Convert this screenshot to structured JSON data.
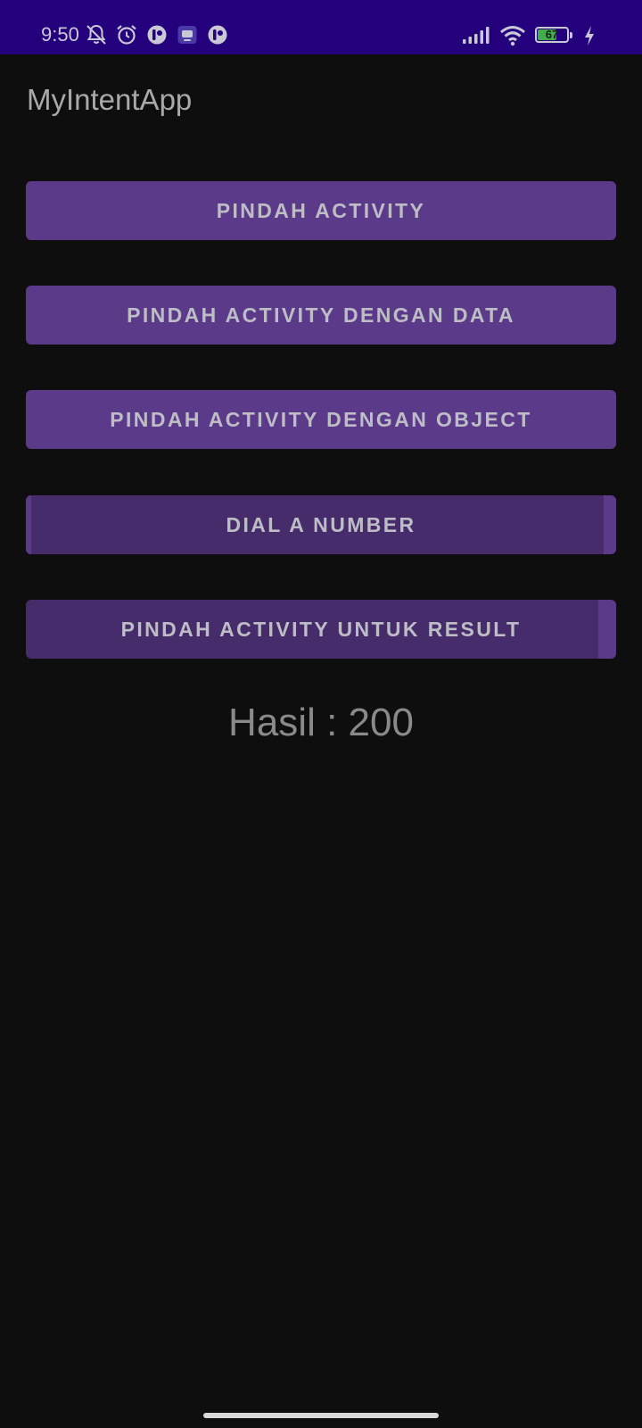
{
  "status_bar": {
    "time": "9:50",
    "battery_level": "67",
    "battery_fill_fraction": 0.67,
    "left_icons": [
      "bell-off-icon",
      "alarm-icon",
      "app-notification-icon",
      "tv-app-icon",
      "app-notification-icon"
    ],
    "right_icons": [
      "signal-icon",
      "wifi-icon",
      "battery-icon",
      "charging-bolt-icon"
    ],
    "colors": {
      "background": "#25007d",
      "foreground": "#c9c9d6",
      "battery_fill": "#3fae4b"
    }
  },
  "app_bar": {
    "title": "MyIntentApp"
  },
  "buttons": [
    {
      "label": "PINDAH ACTIVITY"
    },
    {
      "label": "PINDAH ACTIVITY DENGAN DATA"
    },
    {
      "label": "PINDAH ACTIVITY DENGAN OBJECT"
    },
    {
      "label": "DIAL A NUMBER"
    },
    {
      "label": "PINDAH ACTIVITY UNTUK RESULT"
    }
  ],
  "result": {
    "text": "Hasil : 200"
  },
  "theme": {
    "background": "#0e0e0e",
    "button_color": "#5c3a8a",
    "button_pressed_color": "#462c6a",
    "button_text_color": "#bdbdc6",
    "title_color": "#a9a9a9",
    "result_text_color": "#8a8a8a"
  }
}
